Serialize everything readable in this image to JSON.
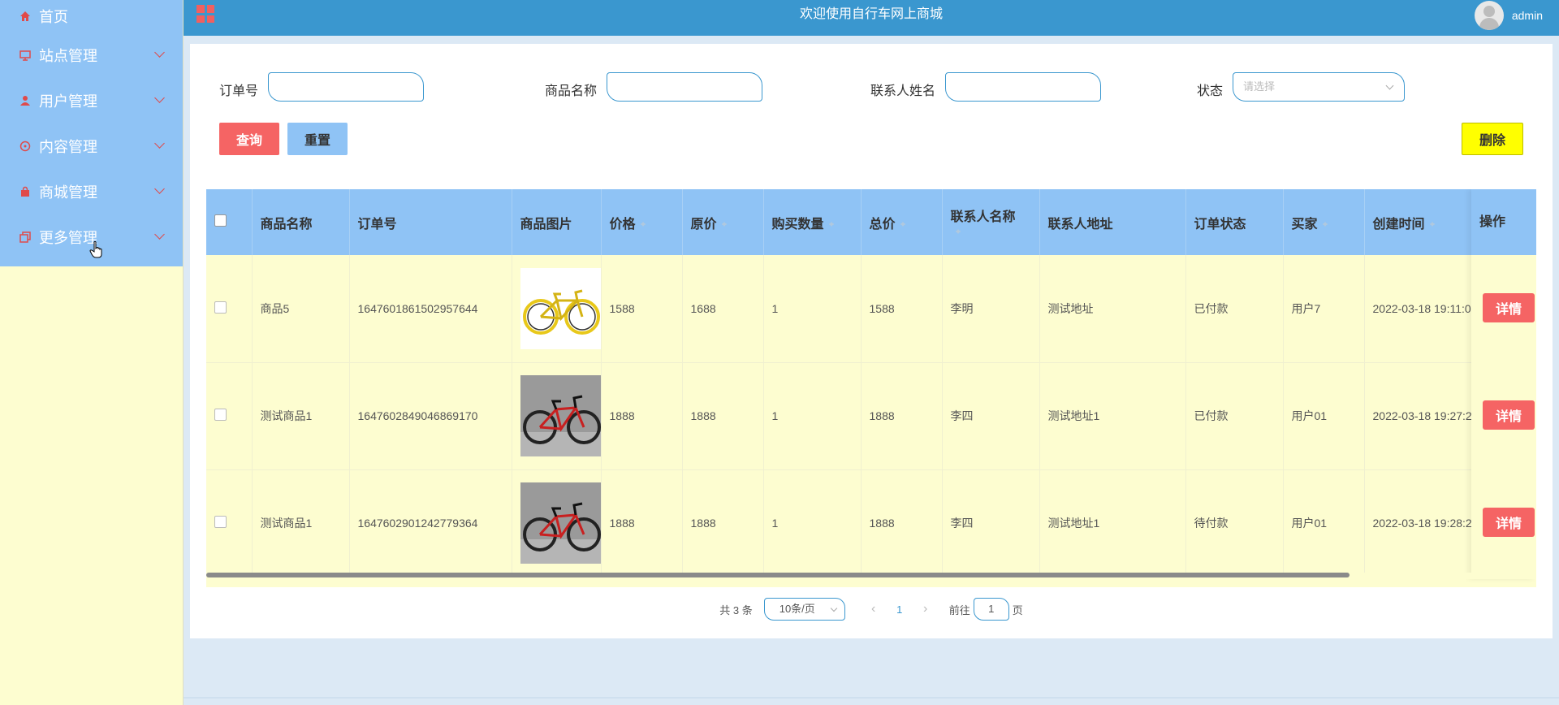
{
  "sidebar": {
    "items": [
      {
        "label": "首页",
        "icon": "home-icon",
        "has_arrow": false
      },
      {
        "label": "站点管理",
        "icon": "monitor-icon",
        "has_arrow": true
      },
      {
        "label": "用户管理",
        "icon": "user-icon",
        "has_arrow": true
      },
      {
        "label": "内容管理",
        "icon": "chat-icon",
        "has_arrow": true
      },
      {
        "label": "商城管理",
        "icon": "bag-icon",
        "has_arrow": true
      },
      {
        "label": "更多管理",
        "icon": "copy-icon",
        "has_arrow": true
      }
    ]
  },
  "header": {
    "title": "欢迎使用自行车网上商城",
    "username": "admin"
  },
  "filters": {
    "order_no_label": "订单号",
    "product_name_label": "商品名称",
    "contact_name_label": "联系人姓名",
    "status_label": "状态",
    "status_placeholder": "请选择"
  },
  "buttons": {
    "search": "查询",
    "reset": "重置",
    "delete": "删除",
    "detail": "详情"
  },
  "table": {
    "columns": [
      "商品名称",
      "订单号",
      "商品图片",
      "价格",
      "原价",
      "购买数量",
      "总价",
      "联系人名称",
      "联系人地址",
      "订单状态",
      "买家",
      "创建时间",
      "操作"
    ],
    "rows": [
      {
        "name": "商品5",
        "order_no": "1647601861502957644",
        "image": "yellow-bicycle",
        "price": "1588",
        "original_price": "1688",
        "quantity": "1",
        "total": "1588",
        "contact": "李明",
        "address": "测试地址",
        "status": "已付款",
        "buyer": "用户7",
        "created": "2022-03-18 19:11:0"
      },
      {
        "name": "测试商品1",
        "order_no": "1647602849046869170",
        "image": "black-red-bicycle",
        "price": "1888",
        "original_price": "1888",
        "quantity": "1",
        "total": "1888",
        "contact": "李四",
        "address": "测试地址1",
        "status": "已付款",
        "buyer": "用户01",
        "created": "2022-03-18 19:27:2"
      },
      {
        "name": "测试商品1",
        "order_no": "1647602901242779364",
        "image": "black-red-bicycle",
        "price": "1888",
        "original_price": "1888",
        "quantity": "1",
        "total": "1888",
        "contact": "李四",
        "address": "测试地址1",
        "status": "待付款",
        "buyer": "用户01",
        "created": "2022-03-18 19:28:2"
      }
    ]
  },
  "pagination": {
    "total_text": "共 3 条",
    "page_size": "10条/页",
    "current_page": "1",
    "goto_label": "前往",
    "goto_value": "1",
    "page_suffix": "页"
  },
  "colors": {
    "sidebar_menu": "#8fc3f5",
    "header": "#3a97cf",
    "danger": "#f56464",
    "delete": "#ffff00",
    "row_bg": "#fdfdd0"
  }
}
